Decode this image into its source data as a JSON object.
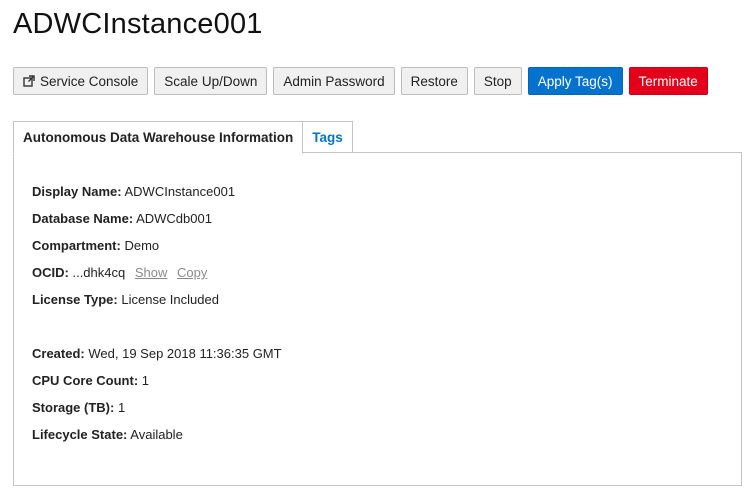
{
  "page": {
    "title": "ADWCInstance001"
  },
  "toolbar": {
    "service_console": "Service Console",
    "scale": "Scale Up/Down",
    "admin_password": "Admin Password",
    "restore": "Restore",
    "stop": "Stop",
    "apply_tags": "Apply Tag(s)",
    "terminate": "Terminate",
    "primary_color": "#0572ce",
    "danger_color": "#e2001a",
    "external_link_icon": "external-link-icon"
  },
  "tabs": [
    {
      "label": "Autonomous Data Warehouse Information",
      "active": true
    },
    {
      "label": "Tags",
      "active": false
    }
  ],
  "info": {
    "display_name": {
      "label": "Display Name:",
      "value": "ADWCInstance001"
    },
    "database_name": {
      "label": "Database Name:",
      "value": "ADWCdb001"
    },
    "compartment": {
      "label": "Compartment:",
      "value": "Demo"
    },
    "ocid": {
      "label": "OCID:",
      "value": "...dhk4cq",
      "show": "Show",
      "copy": "Copy"
    },
    "license_type": {
      "label": "License Type:",
      "value": "License Included"
    },
    "created": {
      "label": "Created:",
      "value": "Wed, 19 Sep 2018 11:36:35 GMT"
    },
    "cpu_core_count": {
      "label": "CPU Core Count:",
      "value": "1"
    },
    "storage": {
      "label": "Storage (TB):",
      "value": "1"
    },
    "lifecycle_state": {
      "label": "Lifecycle State:",
      "value": "Available"
    }
  }
}
